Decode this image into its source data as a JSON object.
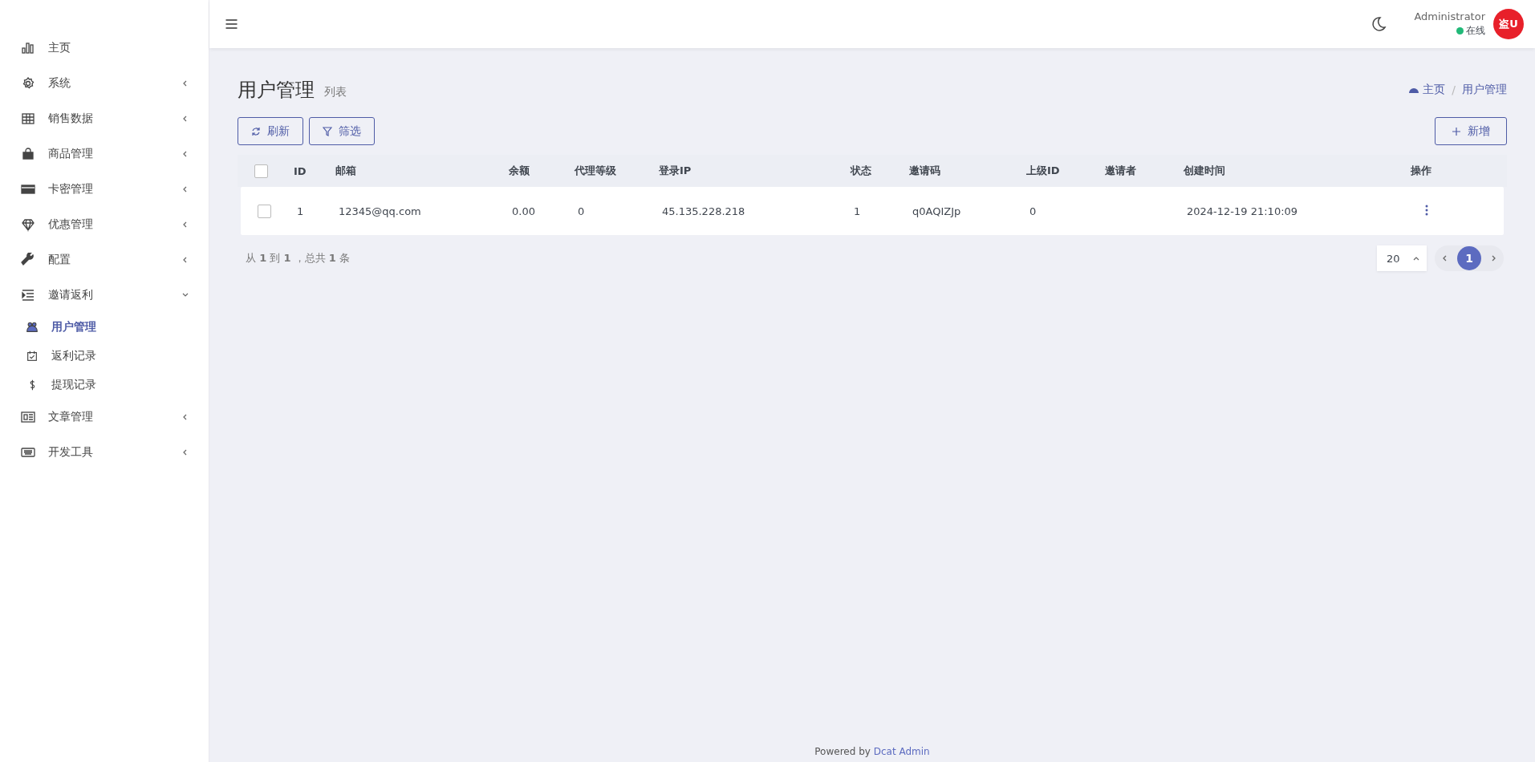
{
  "sidebar": {
    "items": [
      {
        "label": "主页"
      },
      {
        "label": "系统",
        "expanded": false
      },
      {
        "label": "销售数据",
        "expanded": false
      },
      {
        "label": "商品管理",
        "expanded": false
      },
      {
        "label": "卡密管理",
        "expanded": false
      },
      {
        "label": "优惠管理",
        "expanded": false
      },
      {
        "label": "配置",
        "expanded": false
      },
      {
        "label": "邀请返利",
        "expanded": true,
        "children": [
          {
            "label": "用户管理",
            "selected": true
          },
          {
            "label": "返利记录",
            "selected": false
          },
          {
            "label": "提现记录",
            "selected": false
          }
        ]
      },
      {
        "label": "文章管理",
        "expanded": false
      },
      {
        "label": "开发工具",
        "expanded": false
      }
    ]
  },
  "header": {
    "user_name": "Administrator",
    "user_status": "在线",
    "avatar": "盗U"
  },
  "page": {
    "title": "用户管理",
    "subtitle": "列表",
    "breadcrumb": [
      "主页",
      "用户管理"
    ],
    "breadcrumb_separator": "/"
  },
  "toolbar": {
    "left": [
      "刷新",
      "筛选"
    ],
    "right": "新增"
  },
  "table": {
    "select_all_checked": false,
    "columns": [
      "ID",
      "邮箱",
      "余额",
      "代理等级",
      "登录IP",
      "状态",
      "邀请码",
      "上级ID",
      "邀请者",
      "创建时间",
      "操作"
    ],
    "rows": [
      {
        "checked": false,
        "cells": [
          "1",
          "12345@qq.com",
          "0.00",
          "0",
          "45.135.228.218",
          "1",
          "q0AQIZJp",
          "0",
          "",
          "2024-12-19 21:10:09"
        ]
      }
    ]
  },
  "pagination": {
    "summary": "从 **1** 到 **1** ，总共 **1** 条",
    "per_page": "20",
    "pages": [
      {
        "label": "1",
        "selected": true
      }
    ]
  },
  "footer": {
    "text": "Powered by",
    "link": "Dcat Admin"
  }
}
